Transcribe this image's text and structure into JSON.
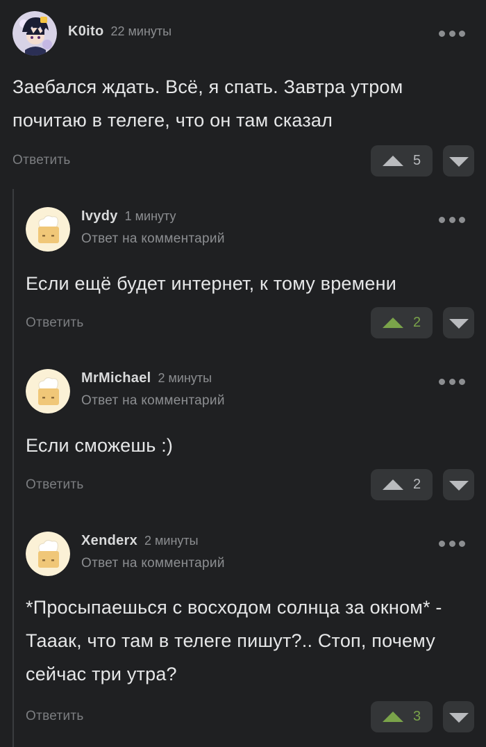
{
  "comments": [
    {
      "username": "K0ito",
      "time": "22 минуты",
      "reply_to": "",
      "text": "Заебался ждать. Всё, я спать. Завтра утром почитаю в телеге, что он там сказал",
      "reply_label": "Ответить",
      "votes": "5",
      "vote_state": "neutral",
      "avatar": "anime-avatar"
    },
    {
      "username": "Ivydy",
      "time": "1 минуту",
      "reply_to": "Ответ на комментарий",
      "text": "Если ещё будет интернет, к тому времени",
      "reply_label": "Ответить",
      "votes": "2",
      "vote_state": "upvoted",
      "avatar": "default-cook-avatar"
    },
    {
      "username": "MrMichael",
      "time": "2 минуты",
      "reply_to": "Ответ на комментарий",
      "text": "Если сможешь :)",
      "reply_label": "Ответить",
      "votes": "2",
      "vote_state": "neutral",
      "avatar": "default-cook-avatar"
    },
    {
      "username": "Xenderx",
      "time": "2 минуты",
      "reply_to": "Ответ на комментарий",
      "text": "*Просыпаешься с восходом солнца за окном* - Тааак, что там в телеге пишут?.. Стоп, почему сейчас три утра?",
      "reply_label": "Ответить",
      "votes": "3",
      "vote_state": "upvoted",
      "avatar": "default-cook-avatar"
    }
  ],
  "colors": {
    "background": "#1f2022",
    "button_bg": "#343638",
    "upvote_active": "#7aa34a",
    "muted_text": "#8c8e91"
  }
}
